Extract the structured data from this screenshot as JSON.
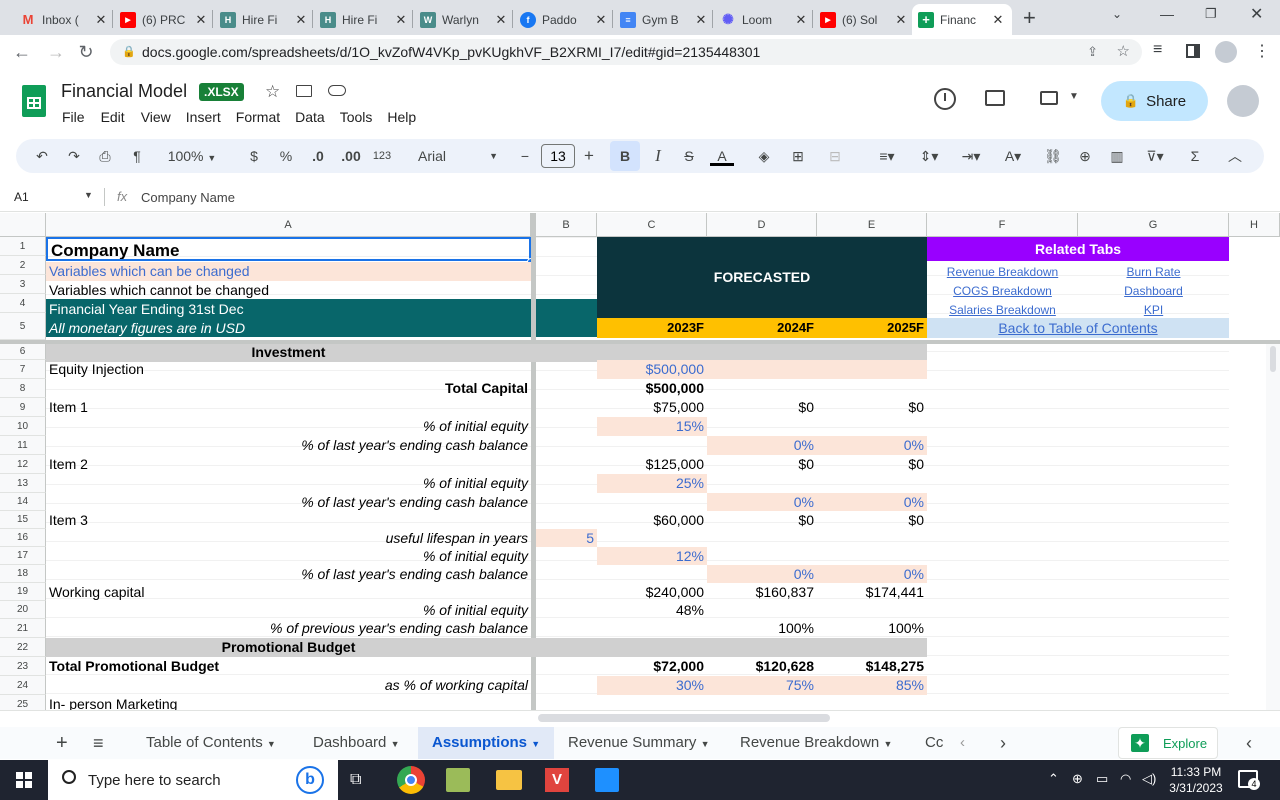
{
  "browser": {
    "tabs": [
      {
        "title": "Inbox (",
        "color": "#ea4335",
        "glyph": "M"
      },
      {
        "title": "(6) PRC",
        "color": "#ff0000",
        "glyph": "▶"
      },
      {
        "title": "Hire Fi",
        "color": "#4a8c8a",
        "glyph": "H"
      },
      {
        "title": "Hire Fi",
        "color": "#4a8c8a",
        "glyph": "H"
      },
      {
        "title": "Warlyn",
        "color": "#4a8c8a",
        "glyph": "W"
      },
      {
        "title": "Paddo",
        "color": "#1877f2",
        "glyph": "f"
      },
      {
        "title": "Gym B",
        "color": "#4285f4",
        "glyph": "≡"
      },
      {
        "title": "Loom",
        "color": "#625df5",
        "glyph": "✺"
      },
      {
        "title": "(6) Sol",
        "color": "#ff0000",
        "glyph": "▶"
      },
      {
        "title": "Financ",
        "color": "#0f9d58",
        "glyph": "+"
      }
    ],
    "url": "docs.google.com/spreadsheets/d/1O_kvZofW4VKp_pvKUgkhVF_B2XRMI_I7/edit#gid=2135448301"
  },
  "doc": {
    "title": "Financial Model",
    "badge": ".XLSX",
    "menus": [
      "File",
      "Edit",
      "View",
      "Insert",
      "Format",
      "Data",
      "Tools",
      "Help"
    ],
    "share_label": "Share"
  },
  "toolbar": {
    "zoom": "100%",
    "currency": "$",
    "percent": "%",
    "dec_less": ".0",
    "dec_more": ".00",
    "format_123": "123",
    "font": "Arial",
    "font_size": "13"
  },
  "formula_bar": {
    "cell_ref": "A1",
    "content": "Company Name"
  },
  "columns": [
    "A",
    "B",
    "C",
    "D",
    "E",
    "F",
    "G",
    "H"
  ],
  "rows": [
    "1",
    "2",
    "3",
    "4",
    "5",
    "6",
    "7",
    "8",
    "9",
    "10",
    "11",
    "12",
    "13",
    "14",
    "15",
    "16",
    "17",
    "18",
    "19",
    "20",
    "21",
    "22",
    "23",
    "24",
    "25"
  ],
  "cells": {
    "a1": "Company Name",
    "a2": "Variables which can be changed",
    "a3": "Variables which cannot be changed",
    "a4": "Financial Year Ending 31st Dec",
    "a5": "All monetary figures are in USD",
    "forecasted": "FORECASTED",
    "y2023": "2023F",
    "y2024": "2024F",
    "y2025": "2025F",
    "related": "Related Tabs",
    "link_rev": "Revenue Breakdown",
    "link_burn": "Burn Rate",
    "link_cogs": "COGS Breakdown",
    "link_dash": "Dashboard",
    "link_sal": "Salaries Breakdown",
    "link_kpi": "KPI",
    "link_back": "Back to Table of Contents",
    "investment": "Investment",
    "equity": "Equity Injection",
    "equity_c": "$500,000",
    "total_capital": "Total Capital",
    "total_capital_c": "$500,000",
    "item1": "Item 1",
    "item1_c": "$75,000",
    "item1_d": "$0",
    "item1_e": "$0",
    "pct_initial": "% of initial equity",
    "item1_pct": "15%",
    "pct_last": "% of last year's ending cash balance",
    "zero_pct": "0%",
    "item2": "Item 2",
    "item2_c": "$125,000",
    "item2_pct": "25%",
    "item3": "Item 3",
    "item3_c": "$60,000",
    "useful": "useful lifespan in years",
    "useful_b": "5",
    "item3_pct": "12%",
    "wc": "Working capital",
    "wc_c": "$240,000",
    "wc_d": "$160,837",
    "wc_e": "$174,441",
    "wc_pct": "48%",
    "pct_prev": "% of previous year's ending cash balance",
    "hundred": "100%",
    "promo": "Promotional Budget",
    "tpb": "Total Promotional Budget",
    "tpb_c": "$72,000",
    "tpb_d": "$120,628",
    "tpb_e": "$148,275",
    "as_wc": "as % of working capital",
    "as_wc_c": "30%",
    "as_wc_d": "75%",
    "as_wc_e": "85%",
    "inperson": "In- person Marketing"
  },
  "sheet_tabs": [
    "Table of Contents",
    "Dashboard",
    "Assumptions",
    "Revenue Summary",
    "Revenue Breakdown",
    "Cc"
  ],
  "explore_label": "Explore",
  "taskbar": {
    "search_placeholder": "Type here to search",
    "time": "11:33 PM",
    "date": "3/31/2023",
    "notif": "4"
  },
  "colors": {
    "teal_dark": "#0c343d",
    "teal": "#08666a",
    "gold": "#ffc000",
    "purple": "#9900ff",
    "pink": "#fce5d9"
  }
}
